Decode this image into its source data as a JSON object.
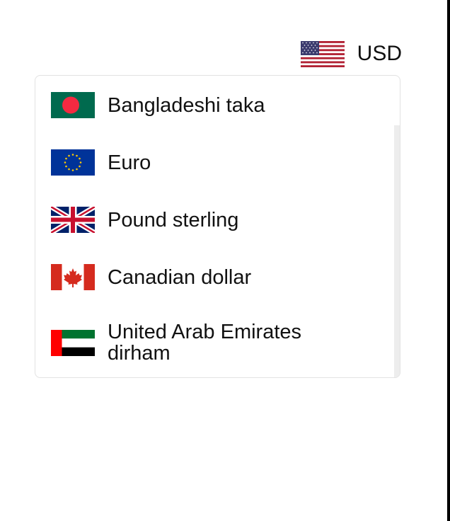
{
  "selector": {
    "flag_icon": "united-states-flag-icon",
    "code": "USD"
  },
  "options": [
    {
      "label": "Bangladeshi taka",
      "flag_icon": "bangladesh-flag-icon"
    },
    {
      "label": "Euro",
      "flag_icon": "european-union-flag-icon"
    },
    {
      "label": "Pound sterling",
      "flag_icon": "united-kingdom-flag-icon"
    },
    {
      "label": "Canadian dollar",
      "flag_icon": "canada-flag-icon"
    },
    {
      "label": "United Arab Emirates dirham",
      "flag_icon": "uae-flag-icon"
    }
  ],
  "colors": {
    "border": "#e2e2e2",
    "scrollbar": "#ededed",
    "text": "#111111"
  }
}
